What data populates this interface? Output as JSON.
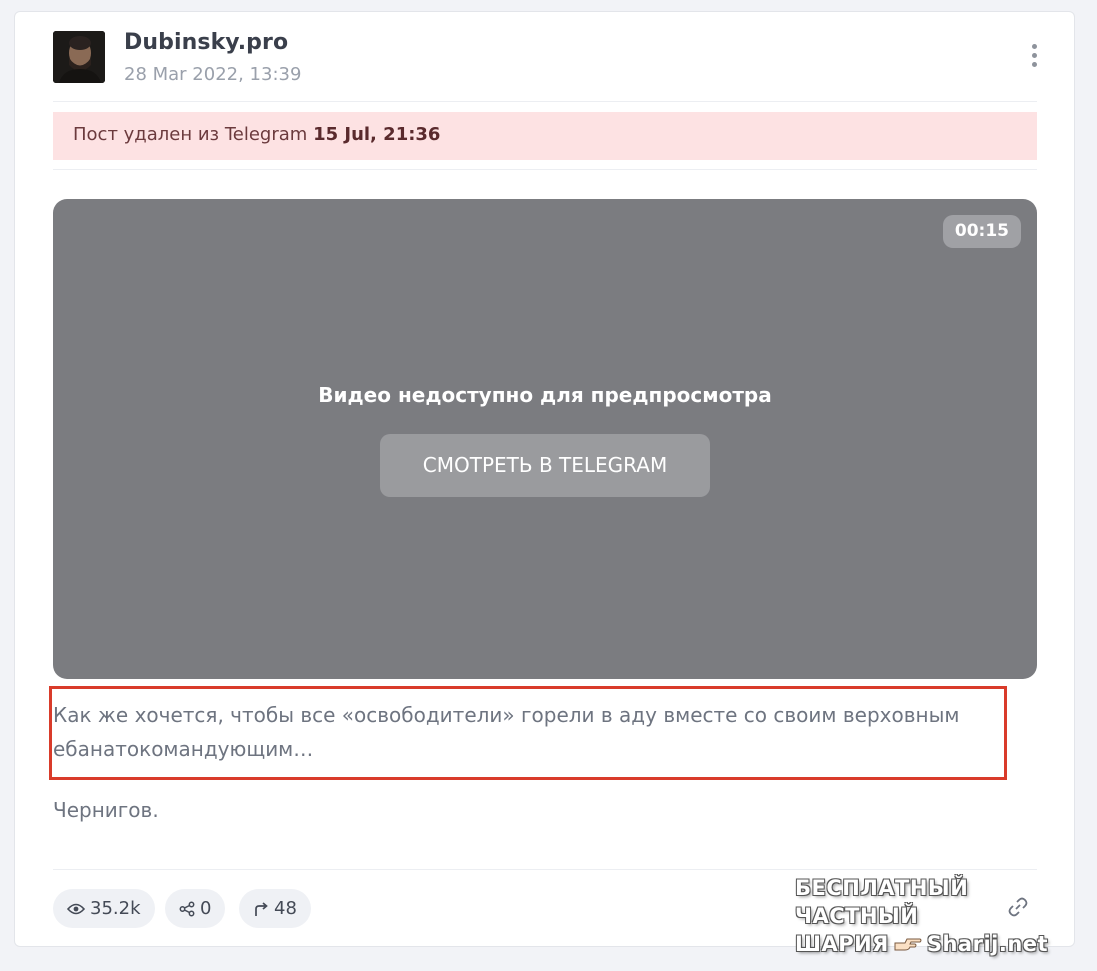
{
  "post": {
    "channel_name": "Dubinsky.pro",
    "date": "28 Mar 2022, 13:39",
    "deleted_prefix": "Пост удален из Telegram",
    "deleted_date": "15 Jul, 21:36",
    "video": {
      "duration": "00:15",
      "message": "Видео недоступно для предпросмотра",
      "button_label": "СМОТРЕТЬ В TELEGRAM"
    },
    "text_line1": "Как же хочется, чтобы все «освободители» горели в аду вместе со своим верховным",
    "text_line2": "ебанатокомандующим…",
    "text_paragraph2": "Чернигов."
  },
  "stats": {
    "views": "35.2k",
    "shares": "0",
    "forwards": "48"
  },
  "watermark": {
    "line1": "БЕСПЛАТНЫЙ ЧАСТНЫЙ",
    "line2_left": "ШАРИЯ",
    "line2_right": "Sharij.net"
  },
  "colors": {
    "banner_bg": "#fde2e3",
    "video_bg": "#7b7c80",
    "highlight_border": "#d93b2a"
  },
  "icons": [
    "more-vert-icon",
    "eye-icon",
    "share-icon",
    "forward-icon",
    "link-icon",
    "pointing-hand-icon"
  ]
}
